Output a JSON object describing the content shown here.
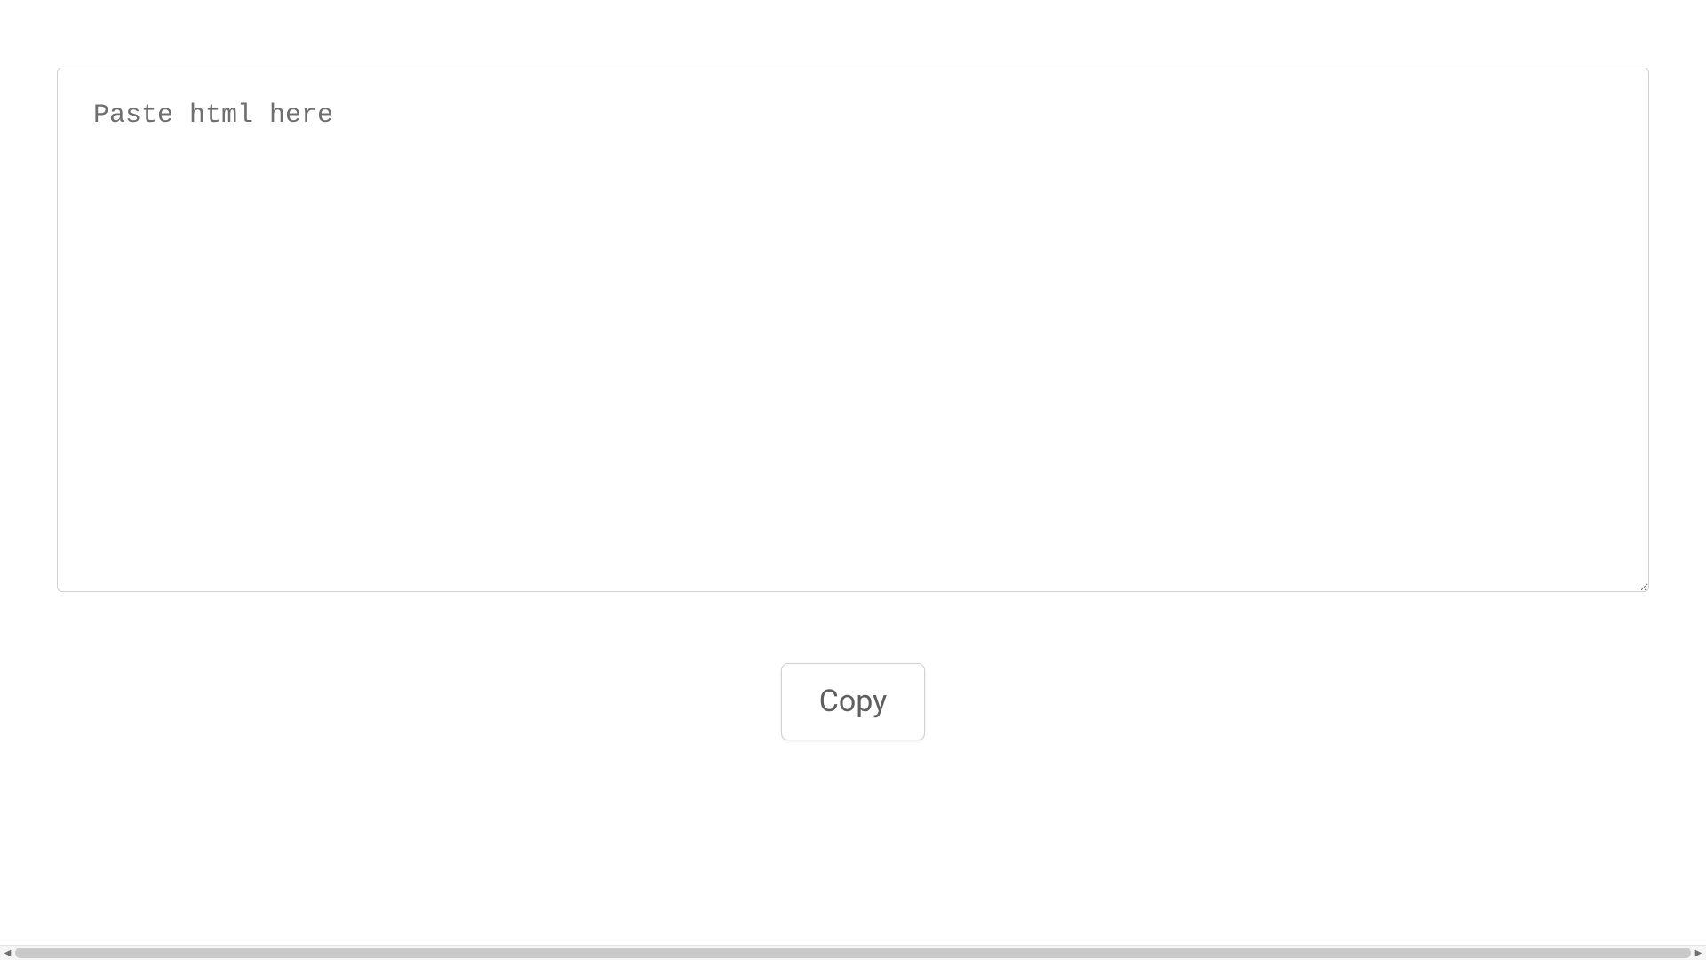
{
  "input": {
    "placeholder": "Paste html here",
    "value": ""
  },
  "actions": {
    "copy_label": "Copy"
  }
}
